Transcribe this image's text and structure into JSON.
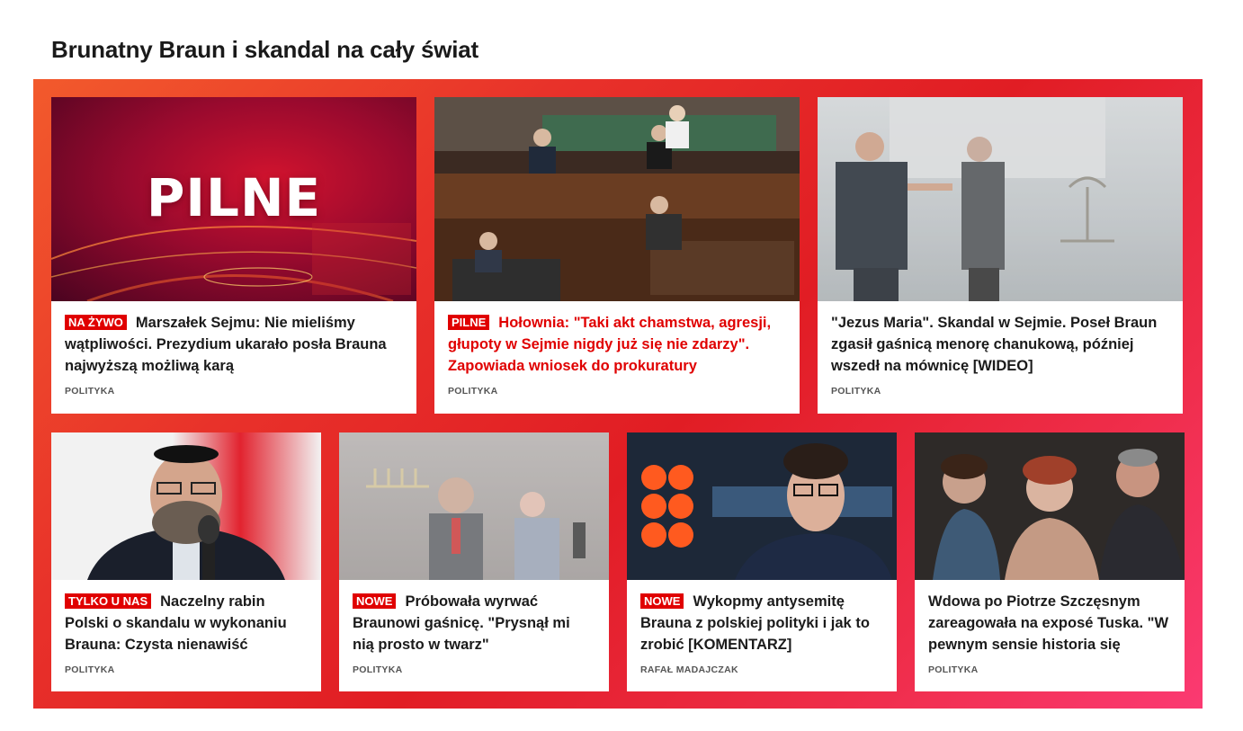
{
  "section": {
    "title": "Brunatny Braun i skandal na cały świat"
  },
  "cards": [
    {
      "badge": "NA ŻYWO",
      "headline": "Marszałek Sejmu: Nie mieliśmy wątpliwości. Prezydium ukarało posła Brauna najwyższą możliwą karą",
      "category": "POLITYKA",
      "image_label": "PILNE"
    },
    {
      "badge": "PILNE",
      "headline": "Hołownia: \"Taki akt chamstwa, agresji, głupoty w Sejmie nigdy już się nie zdarzy\". Zapowiada wniosek do prokuratury",
      "category": "POLITYKA",
      "red": true
    },
    {
      "badge": "",
      "headline": "\"Jezus Maria\". Skandal w Sejmie. Poseł Braun zgasił gaśnicą menorę chanukową, później wszedł na mównicę [WIDEO]",
      "category": "POLITYKA"
    },
    {
      "badge": "TYLKO U NAS",
      "headline": "Naczelny rabin Polski o skandalu w wykonaniu Brauna: Czysta nienawiść",
      "category": "POLITYKA"
    },
    {
      "badge": "NOWE",
      "headline": "Próbowała wyrwać Braunowi gaśnicę. \"Prysnął mi nią prosto w twarz\"",
      "category": "POLITYKA"
    },
    {
      "badge": "NOWE",
      "headline": "Wykopmy antysemitę Brauna z polskiej polityki i jak to zrobić [KOMENTARZ]",
      "category": "RAFAŁ MADAJCZAK"
    },
    {
      "badge": "",
      "headline": "Wdowa po Piotrze Szczęsnym zareagowała na exposé Tuska. \"W pewnym sensie historia się",
      "category": "POLITYKA"
    }
  ],
  "colors": {
    "accent": "#e00000",
    "panel_start": "#f25a2c",
    "panel_end": "#fb3a72"
  }
}
